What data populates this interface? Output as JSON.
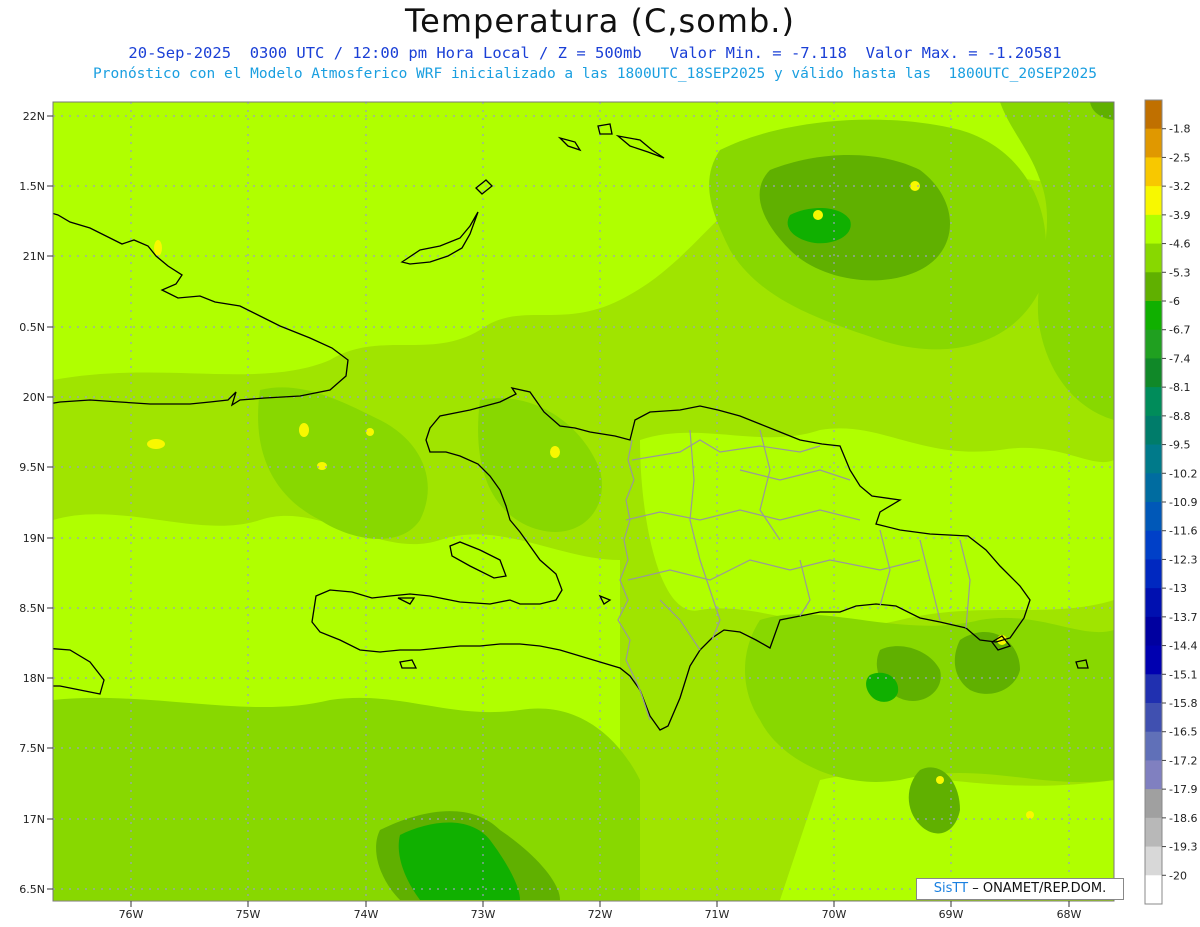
{
  "header": {
    "title": "Temperatura (C,somb.)",
    "line1": "20-Sep-2025  0300 UTC / 12:00 pm Hora Local / Z = 500mb   Valor Min. = -7.118  Valor Max. = -1.20581",
    "line2": "Pronóstico con el Modelo Atmosferico WRF inicializado a las 1800UTC_18SEP2025 y válido hasta las  1800UTC_20SEP2025"
  },
  "axes": {
    "lat_labels": [
      "22N",
      "1.5N",
      "21N",
      "0.5N",
      "20N",
      "9.5N",
      "19N",
      "8.5N",
      "18N",
      "7.5N",
      "17N",
      "6.5N"
    ],
    "lon_labels": [
      "76W",
      "75W",
      "74W",
      "73W",
      "72W",
      "71W",
      "70W",
      "69W",
      "68W"
    ]
  },
  "colorbar": {
    "labels": [
      "-1.8",
      "-2.5",
      "-3.2",
      "-3.9",
      "-4.6",
      "-5.3",
      "-6",
      "-6.7",
      "-7.4",
      "-8.1",
      "-8.8",
      "-9.5",
      "-10.2",
      "-10.9",
      "-11.6",
      "-12.3",
      "-13",
      "-13.7",
      "-14.4",
      "-15.1",
      "-15.8",
      "-16.5",
      "-17.2",
      "-17.9",
      "-18.6",
      "-19.3",
      "-20"
    ],
    "colors": [
      "#c07000",
      "#e09800",
      "#f8c800",
      "#f8f800",
      "#b0ff00",
      "#88d800",
      "#60b000",
      "#10b000",
      "#20a020",
      "#108828",
      "#008c5a",
      "#007c6a",
      "#007a8a",
      "#006ca0",
      "#0058b8",
      "#0040c8",
      "#0028c0",
      "#0010b0",
      "#0000a0",
      "#0000b0",
      "#2030b0",
      "#4050b0",
      "#6070b8",
      "#8080c0",
      "#a0a0a0",
      "#b8b8b8",
      "#d8d8d8",
      "#ffffff"
    ]
  },
  "map_colors": {
    "base": "#a0e400",
    "light": "#b0ff00",
    "mid": "#88d800",
    "dark": "#60b000",
    "deep": "#10b000",
    "yellow": "#f8f800",
    "coast": "#000000",
    "border": "#999999",
    "grid": "#9aa0c0"
  },
  "credit": {
    "brand": "SisTT",
    "text": "– ONAMET/REP.DOM."
  }
}
